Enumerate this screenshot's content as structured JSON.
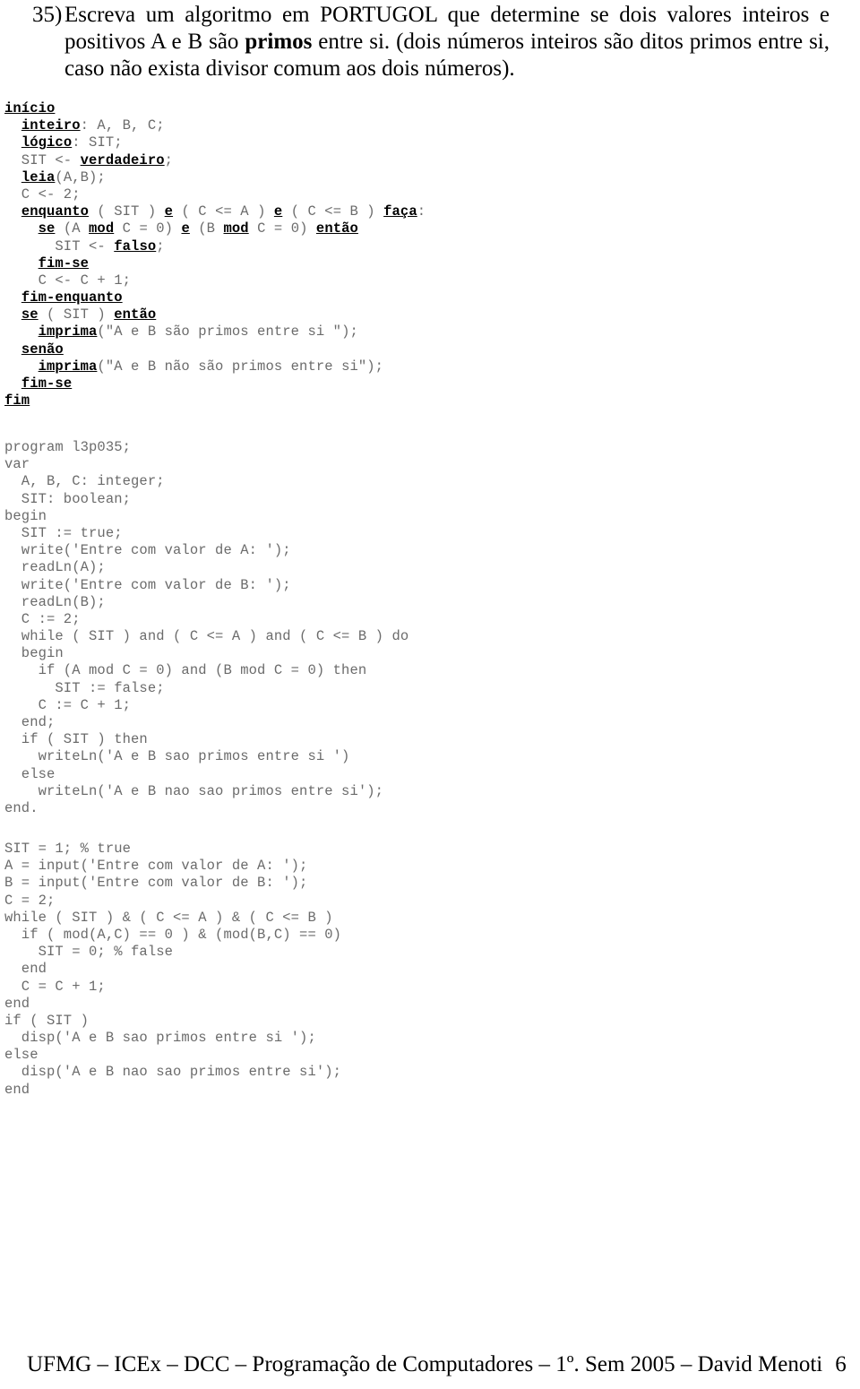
{
  "question": {
    "number": "35)",
    "lines": [
      "Escreva um algoritmo em PORTUGOL que determine se dois valores inteiros e",
      "positivos A e B são ",
      "primos",
      " entre si. (dois números inteiros são ditos primos entre si,",
      "caso não exista divisor comum aos dois números)."
    ],
    "line1": "Escreva um algoritmo em PORTUGOL que determine se dois valores inteiros e",
    "line2_pre": "positivos A e B são ",
    "line2_bold": "primos",
    "line2_post": " entre si. (dois números inteiros são ditos primos entre si,",
    "line3": "caso não exista divisor comum aos dois números)."
  },
  "portugol": {
    "language": "PORTUGOL",
    "lines": [
      [
        {
          "t": "início",
          "k": true
        }
      ],
      [
        {
          "t": "  ",
          "k": false
        },
        {
          "t": "inteiro",
          "k": true
        },
        {
          "t": ": A, B, C;",
          "k": false
        }
      ],
      [
        {
          "t": "  ",
          "k": false
        },
        {
          "t": "lógico",
          "k": true
        },
        {
          "t": ": SIT;",
          "k": false
        }
      ],
      [
        {
          "t": "  SIT <- ",
          "k": false
        },
        {
          "t": "verdadeiro",
          "k": true
        },
        {
          "t": ";",
          "k": false
        }
      ],
      [
        {
          "t": "  ",
          "k": false
        },
        {
          "t": "leia",
          "k": true
        },
        {
          "t": "(A,B);",
          "k": false
        }
      ],
      [
        {
          "t": "  C <- 2;",
          "k": false
        }
      ],
      [
        {
          "t": "  ",
          "k": false
        },
        {
          "t": "enquanto",
          "k": true
        },
        {
          "t": " ( SIT ) ",
          "k": false
        },
        {
          "t": "e",
          "k": true
        },
        {
          "t": " ( C <= A ) ",
          "k": false
        },
        {
          "t": "e",
          "k": true
        },
        {
          "t": " ( C <= B ) ",
          "k": false
        },
        {
          "t": "faça",
          "k": true
        },
        {
          "t": ":",
          "k": false
        }
      ],
      [
        {
          "t": "    ",
          "k": false
        },
        {
          "t": "se",
          "k": true
        },
        {
          "t": " (A ",
          "k": false
        },
        {
          "t": "mod",
          "k": true
        },
        {
          "t": " C = 0) ",
          "k": false
        },
        {
          "t": "e",
          "k": true
        },
        {
          "t": " (B ",
          "k": false
        },
        {
          "t": "mod",
          "k": true
        },
        {
          "t": " C = 0) ",
          "k": false
        },
        {
          "t": "então",
          "k": true
        }
      ],
      [
        {
          "t": "      SIT <- ",
          "k": false
        },
        {
          "t": "falso",
          "k": true
        },
        {
          "t": ";",
          "k": false
        }
      ],
      [
        {
          "t": "    ",
          "k": false
        },
        {
          "t": "fim-se",
          "k": true
        }
      ],
      [
        {
          "t": "    C <- C + 1;",
          "k": false
        }
      ],
      [
        {
          "t": "  ",
          "k": false
        },
        {
          "t": "fim-enquanto",
          "k": true
        }
      ],
      [
        {
          "t": "  ",
          "k": false
        },
        {
          "t": "se",
          "k": true
        },
        {
          "t": " ( SIT ) ",
          "k": false
        },
        {
          "t": "então",
          "k": true
        }
      ],
      [
        {
          "t": "    ",
          "k": false
        },
        {
          "t": "imprima",
          "k": true
        },
        {
          "t": "(\"A e B são primos entre si \");",
          "k": false
        }
      ],
      [
        {
          "t": "  ",
          "k": false
        },
        {
          "t": "senão",
          "k": true
        }
      ],
      [
        {
          "t": "    ",
          "k": false
        },
        {
          "t": "imprima",
          "k": true
        },
        {
          "t": "(\"A e B não são primos entre si\");",
          "k": false
        }
      ],
      [
        {
          "t": "  ",
          "k": false
        },
        {
          "t": "fim-se",
          "k": true
        }
      ],
      [
        {
          "t": "fim",
          "k": true
        }
      ]
    ]
  },
  "pascal": {
    "language": "Pascal",
    "lines": [
      [
        {
          "t": "program l3p035;",
          "k": false
        }
      ],
      [
        {
          "t": "var",
          "k": false
        }
      ],
      [
        {
          "t": "  A, B, C: integer;",
          "k": false
        }
      ],
      [
        {
          "t": "  SIT: boolean;",
          "k": false
        }
      ],
      [
        {
          "t": "begin",
          "k": false
        }
      ],
      [
        {
          "t": "  SIT := true;",
          "k": false
        }
      ],
      [
        {
          "t": "  write('Entre com valor de A: ');",
          "k": false
        }
      ],
      [
        {
          "t": "  readLn(A);",
          "k": false
        }
      ],
      [
        {
          "t": "  write('Entre com valor de B: ');",
          "k": false
        }
      ],
      [
        {
          "t": "  readLn(B);",
          "k": false
        }
      ],
      [
        {
          "t": "  C := 2;",
          "k": false
        }
      ],
      [
        {
          "t": "  while ( SIT ) and ( C <= A ) and ( C <= B ) do",
          "k": false
        }
      ],
      [
        {
          "t": "  begin",
          "k": false
        }
      ],
      [
        {
          "t": "    if (A mod C = 0) and (B mod C = 0) then",
          "k": false
        }
      ],
      [
        {
          "t": "      SIT := false;",
          "k": false
        }
      ],
      [
        {
          "t": "    C := C + 1;",
          "k": false
        }
      ],
      [
        {
          "t": "  end;",
          "k": false
        }
      ],
      [
        {
          "t": "  if ( SIT ) then",
          "k": false
        }
      ],
      [
        {
          "t": "    writeLn('A e B sao primos entre si ')",
          "k": false
        }
      ],
      [
        {
          "t": "  else",
          "k": false
        }
      ],
      [
        {
          "t": "    writeLn('A e B nao sao primos entre si');",
          "k": false
        }
      ],
      [
        {
          "t": "end.",
          "k": false
        }
      ]
    ]
  },
  "matlab": {
    "language": "MATLAB",
    "lines": [
      [
        {
          "t": "SIT = 1; % true",
          "k": false
        }
      ],
      [
        {
          "t": "A = input('Entre com valor de A: ');",
          "k": false
        }
      ],
      [
        {
          "t": "B = input('Entre com valor de B: ');",
          "k": false
        }
      ],
      [
        {
          "t": "C = 2;",
          "k": false
        }
      ],
      [
        {
          "t": "while ( SIT ) & ( C <= A ) & ( C <= B )",
          "k": false
        }
      ],
      [
        {
          "t": "  if ( mod(A,C) == 0 ) & (mod(B,C) == 0)",
          "k": false
        }
      ],
      [
        {
          "t": "    SIT = 0; % false",
          "k": false
        }
      ],
      [
        {
          "t": "  end",
          "k": false
        }
      ],
      [
        {
          "t": "  C = C + 1;",
          "k": false
        }
      ],
      [
        {
          "t": "end",
          "k": false
        }
      ],
      [
        {
          "t": "if ( SIT )",
          "k": false
        }
      ],
      [
        {
          "t": "  disp('A e B sao primos entre si ');",
          "k": false
        }
      ],
      [
        {
          "t": "else",
          "k": false
        }
      ],
      [
        {
          "t": "  disp('A e B nao sao primos entre si');",
          "k": false
        }
      ],
      [
        {
          "t": "end",
          "k": false
        }
      ]
    ]
  },
  "footer": {
    "text": "UFMG – ICEx – DCC – Programação de Computadores – 1º. Sem 2005 – David Menoti",
    "page": "6"
  },
  "colors": {
    "code_plain": "#6b6b6b",
    "code_keyword": "#000000",
    "text": "#000000",
    "background": "#ffffff"
  }
}
